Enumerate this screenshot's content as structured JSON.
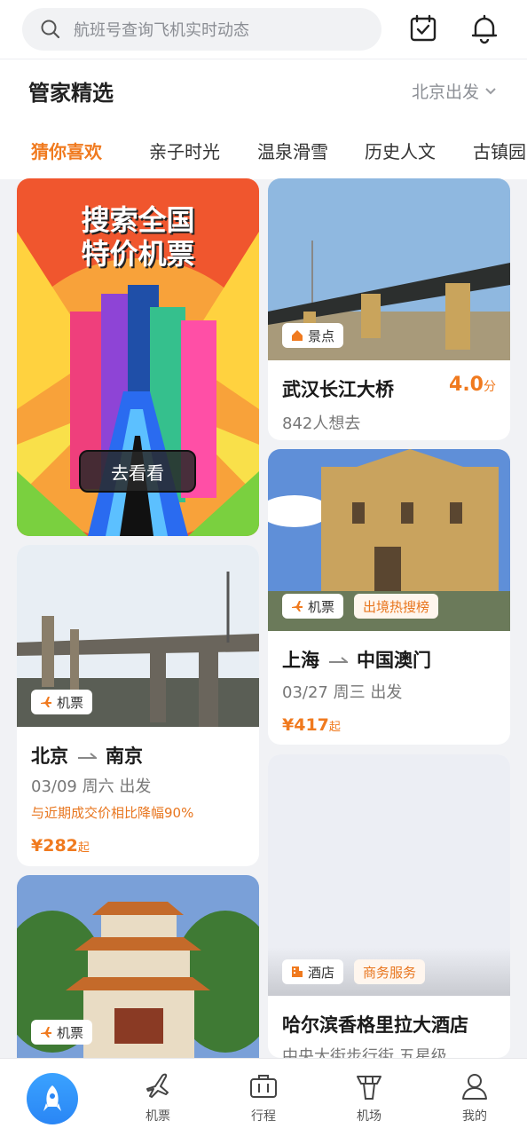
{
  "search": {
    "placeholder": "航班号查询飞机实时动态"
  },
  "header": {
    "title": "管家精选",
    "city": "北京出发"
  },
  "tabs": [
    "猜你喜欢",
    "亲子时光",
    "温泉滑雪",
    "历史人文",
    "古镇园"
  ],
  "promo": {
    "banner_line1": "搜索全国",
    "banner_line2": "特价机票",
    "cta": "去看看"
  },
  "cards": {
    "bridge": {
      "badge": "景点",
      "title": "武汉长江大桥",
      "score": "4.0",
      "score_unit": "分",
      "sub": "842人想去"
    },
    "macau": {
      "badge": "机票",
      "badge2": "出境热搜榜",
      "from": "上海",
      "to": "中国澳门",
      "date": "03/27 周三 出发",
      "price": "¥417",
      "price_unit": "起"
    },
    "nanjing": {
      "badge": "机票",
      "from": "北京",
      "to": "南京",
      "date": "03/09 周六 出发",
      "tip": "与近期成交价相比降幅90%",
      "price": "¥282",
      "price_unit": "起"
    },
    "pagoda": {
      "badge": "机票"
    },
    "hotel": {
      "badge": "酒店",
      "badge2": "商务服务",
      "title": "哈尔滨香格里拉大酒店",
      "sub": "中央大街步行街 五星级"
    }
  },
  "nav": {
    "flights": "机票",
    "trips": "行程",
    "airport": "机场",
    "mine": "我的"
  },
  "colors": {
    "accent": "#f07a1f",
    "primary": "#2a86f5"
  }
}
